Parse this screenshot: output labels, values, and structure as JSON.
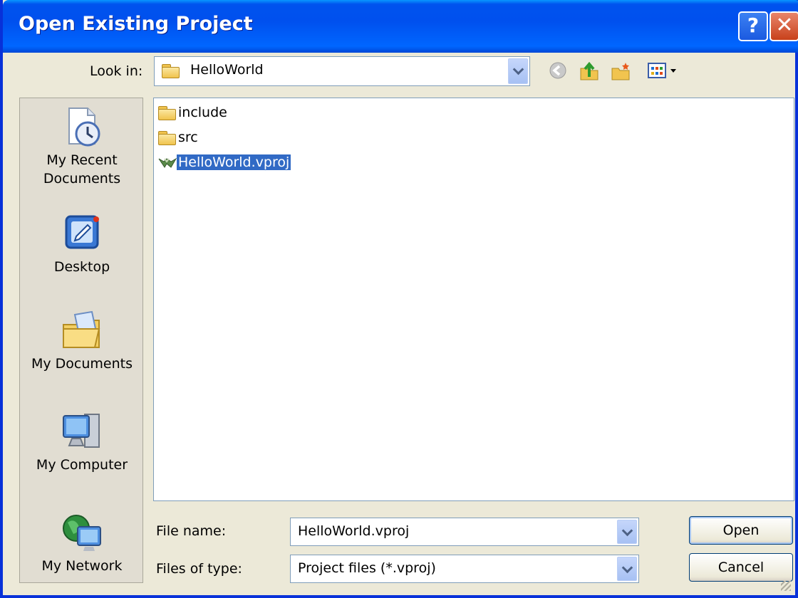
{
  "window": {
    "title": "Open Existing Project",
    "help_glyph": "?",
    "close_glyph": "✕"
  },
  "lookin": {
    "label": "Look in:",
    "value": "HelloWorld"
  },
  "toolbar": {
    "icons": [
      "back-icon",
      "up-folder-icon",
      "new-folder-icon",
      "views-menu-icon"
    ]
  },
  "places": [
    {
      "label": "My Recent Documents",
      "line1": "My Recent",
      "line2": "Documents",
      "icon": "recent-documents-icon"
    },
    {
      "label": "Desktop",
      "icon": "desktop-icon"
    },
    {
      "label": "My Documents",
      "icon": "my-documents-icon"
    },
    {
      "label": "My Computer",
      "icon": "my-computer-icon"
    },
    {
      "label": "My Network",
      "icon": "my-network-icon"
    }
  ],
  "files": [
    {
      "name": "include",
      "type": "folder",
      "selected": false
    },
    {
      "name": "src",
      "type": "folder",
      "selected": false
    },
    {
      "name": "HelloWorld.vproj",
      "type": "project",
      "selected": true
    }
  ],
  "filename": {
    "label": "File name:",
    "value": "HelloWorld.vproj"
  },
  "filetype": {
    "label": "Files of type:",
    "value": "Project files (*.vproj)"
  },
  "buttons": {
    "open": "Open",
    "cancel": "Cancel"
  },
  "colors": {
    "titlebar": "#0054e3",
    "selection": "#316ac5",
    "frame": "#ece9d8"
  }
}
